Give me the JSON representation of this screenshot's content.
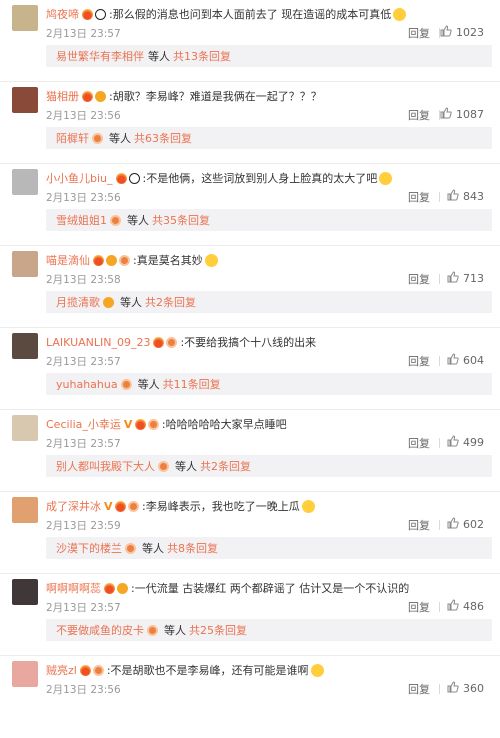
{
  "comments": [
    {
      "user": "鸠夜啼",
      "badges": [
        "fire",
        "panda"
      ],
      "text": ":那么假的消息也问到本人面前去了 现在造谣的成本可真低",
      "emoji": true,
      "time": "2月13日 23:57",
      "reply": "回复",
      "likes": "1023",
      "sub_user": "易世繁华有李相伴",
      "sub_badges": [],
      "sub_rest": "等人",
      "sub_count": "共13条回复",
      "avatar_color": "#c7b38c"
    },
    {
      "user": "猫相册",
      "badges": [
        "fire",
        "vip"
      ],
      "text": ":胡歌？李易峰？难道是我俩在一起了？？？",
      "emoji": false,
      "time": "2月13日 23:56",
      "reply": "回复",
      "likes": "1087",
      "sub_user": "陌樨轩",
      "sub_badges": [
        "fan"
      ],
      "sub_rest": "等人",
      "sub_count": "共63条回复",
      "avatar_color": "#8a4a3a"
    },
    {
      "user": "小小鱼儿biu_",
      "badges": [
        "fire",
        "panda"
      ],
      "text": ":不是他俩，这些词放到别人身上脸真的太大了吧",
      "emoji": true,
      "time": "2月13日 23:56",
      "reply": "回复",
      "likes": "843",
      "sub_user": "雪绒姐姐1",
      "sub_badges": [
        "fan"
      ],
      "sub_rest": "等人",
      "sub_count": "共35条回复",
      "avatar_color": "#b8b8b8"
    },
    {
      "user": "喵是滴仙",
      "badges": [
        "fire",
        "vip",
        "fan"
      ],
      "text": ":真是莫名其妙",
      "emoji": true,
      "time": "2月13日 23:58",
      "reply": "回复",
      "likes": "713",
      "sub_user": "月揽清歌",
      "sub_badges": [
        "vip"
      ],
      "sub_rest": "等人",
      "sub_count": "共2条回复",
      "avatar_color": "#c9a58a"
    },
    {
      "user": "LAIKUANLIN_09_23",
      "badges": [
        "fire",
        "fan"
      ],
      "text": ":不要给我搞个十八线的出来",
      "emoji": false,
      "time": "2月13日 23:57",
      "reply": "回复",
      "likes": "604",
      "sub_user": "yuhahahua",
      "sub_badges": [
        "fan"
      ],
      "sub_rest": "等人",
      "sub_count": "共11条回复",
      "avatar_color": "#5a4a40"
    },
    {
      "user": "Cecilia_小幸运",
      "badges": [
        "v",
        "fire",
        "fan"
      ],
      "text": ":哈哈哈哈哈大家早点睡吧",
      "emoji": false,
      "time": "2月13日 23:57",
      "reply": "回复",
      "likes": "499",
      "sub_user": "别人都叫我殿下大人",
      "sub_badges": [
        "fan"
      ],
      "sub_rest": "等人",
      "sub_count": "共2条回复",
      "avatar_color": "#d8c8b0"
    },
    {
      "user": "成了深井冰",
      "badges": [
        "v",
        "fire",
        "fan"
      ],
      "text": ":李易峰表示，我也吃了一晚上瓜",
      "emoji": true,
      "time": "2月13日 23:59",
      "reply": "回复",
      "likes": "602",
      "sub_user": "沙漠下的楼兰",
      "sub_badges": [
        "fan"
      ],
      "sub_rest": "等人",
      "sub_count": "共8条回复",
      "avatar_color": "#e0a070"
    },
    {
      "user": "啊啊啊啊蕊",
      "badges": [
        "fire",
        "vip"
      ],
      "text": ":一代流量 古装爆红 两个都辟谣了 估计又是一个不认识的",
      "emoji": false,
      "time": "2月13日 23:57",
      "reply": "回复",
      "likes": "486",
      "sub_user": "不要做咸鱼的皮卡",
      "sub_badges": [
        "fan"
      ],
      "sub_rest": "等人",
      "sub_count": "共25条回复",
      "avatar_color": "#403838"
    },
    {
      "user": "贼亮zl",
      "badges": [
        "fire",
        "fan"
      ],
      "text": ":不是胡歌也不是李易峰，还有可能是谁啊",
      "emoji": true,
      "time": "2月13日 23:56",
      "reply": "回复",
      "likes": "360",
      "sub_user": "",
      "sub_badges": [],
      "sub_rest": "",
      "sub_count": "",
      "avatar_color": "#e8a8a0"
    }
  ]
}
